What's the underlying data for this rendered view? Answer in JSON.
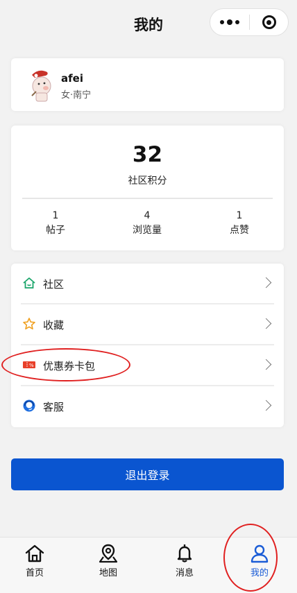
{
  "header": {
    "title": "我的"
  },
  "profile": {
    "name": "afei",
    "meta": "女·南宁"
  },
  "stats": {
    "score": "32",
    "score_label": "社区积分",
    "items": [
      {
        "value": "1",
        "label": "帖子"
      },
      {
        "value": "4",
        "label": "浏览量"
      },
      {
        "value": "1",
        "label": "点赞"
      }
    ]
  },
  "menu": [
    {
      "label": "社区",
      "icon": "home-icon"
    },
    {
      "label": "收藏",
      "icon": "star-icon"
    },
    {
      "label": "优惠券卡包",
      "icon": "coupon-icon"
    },
    {
      "label": "客服",
      "icon": "support-icon"
    }
  ],
  "logout_label": "退出登录",
  "tabs": [
    {
      "label": "首页",
      "icon": "home-icon"
    },
    {
      "label": "地图",
      "icon": "map-pin-icon"
    },
    {
      "label": "消息",
      "icon": "bell-icon"
    },
    {
      "label": "我的",
      "icon": "user-icon",
      "active": true
    }
  ],
  "colors": {
    "accent": "#0a55d0",
    "active_tab": "#1a5cd6",
    "annotation": "#e02020"
  }
}
